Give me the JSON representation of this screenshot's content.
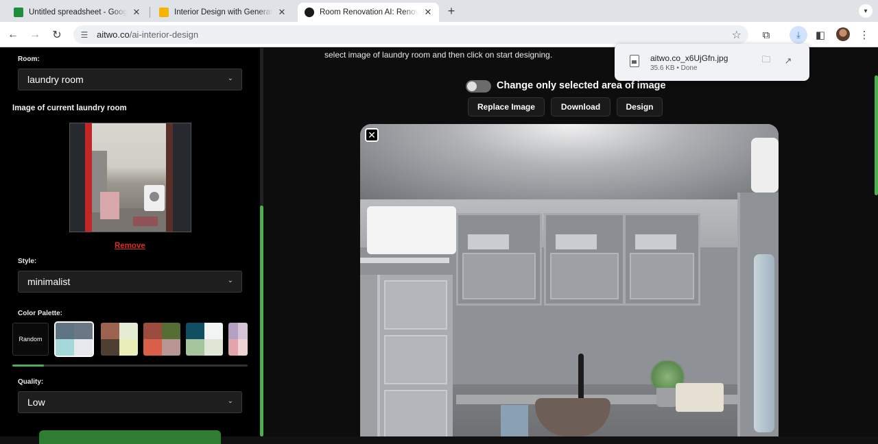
{
  "browser": {
    "tabs": [
      {
        "title": "Untitled spreadsheet - Google Sheets",
        "favicon_color": "#1e8e3e",
        "active": false
      },
      {
        "title": "Interior Design with Generative AI",
        "favicon_color": "#f4b400",
        "active": false
      },
      {
        "title": "Room Renovation AI: Renovate",
        "favicon_color": "#1a1a1a",
        "active": true
      }
    ],
    "url_host": "aitwo.co",
    "url_path": "/ai-interior-design",
    "icons": {
      "back": "back-arrow-icon",
      "forward": "forward-arrow-icon",
      "reload": "reload-icon",
      "site_settings": "tune-icon",
      "bookmark": "star-icon",
      "extensions": "puzzle-icon",
      "downloads": "download-icon",
      "side_panel": "side-panel-icon",
      "menu": "kebab-menu-icon"
    }
  },
  "sidebar": {
    "room_label": "Room:",
    "room_value": "laundry room",
    "image_heading": "Image of current laundry room",
    "remove_label": "Remove",
    "style_label": "Style:",
    "style_value": "minimalist",
    "palette_label": "Color Palette:",
    "random_label": "Random",
    "palettes": [
      {
        "colors": [
          "#5f7483",
          "#6a7886",
          "#a4d8d9",
          "#e7e8ec"
        ],
        "selected": true
      },
      {
        "colors": [
          "#9c634f",
          "#e4ecd3",
          "#4f3f32",
          "#e9eeb8"
        ],
        "selected": false
      },
      {
        "colors": [
          "#9a4d3e",
          "#566d34",
          "#d95f49",
          "#b89493"
        ],
        "selected": false
      },
      {
        "colors": [
          "#0f4e63",
          "#f2f3f4",
          "#a7c59c",
          "#dfe6d6"
        ],
        "selected": false
      },
      {
        "colors": [
          "#b4a0c0",
          "#d5c4d5",
          "#e2a5ab",
          "#f0d2d4"
        ],
        "selected": false
      }
    ],
    "quality_label": "Quality:",
    "quality_value": "Low"
  },
  "main": {
    "instruction": "select image of laundry room and then click on start designing.",
    "toggle_label": "Change only selected area of image",
    "toggle_on": false,
    "buttons": {
      "replace": "Replace Image",
      "download": "Download",
      "design": "Design"
    },
    "close_symbol": "✕"
  },
  "download_popup": {
    "filename": "aitwo.co_x6UjGfn.jpg",
    "meta": "35.6 KB • Done"
  },
  "colors": {
    "accent": "#4caf50",
    "remove": "#d93025"
  }
}
